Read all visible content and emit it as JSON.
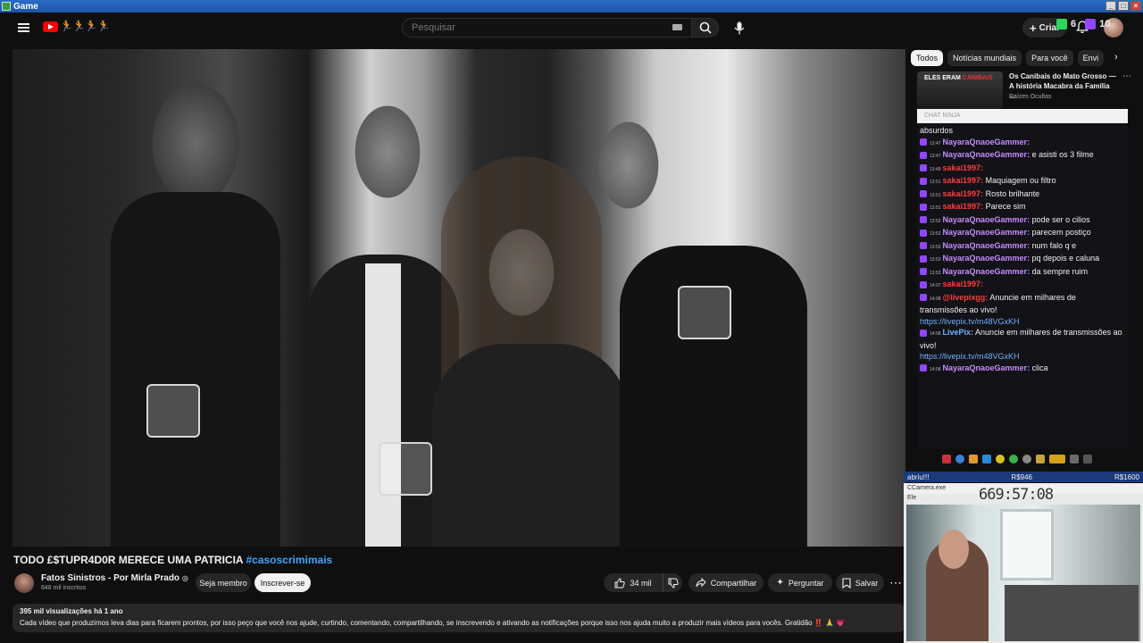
{
  "window": {
    "title": "Game"
  },
  "masthead": {
    "search_placeholder": "Pesquisar",
    "doodle": "🏃🏃🏃🏃",
    "create_label": "Criar"
  },
  "video": {
    "title": "TODO £$TUPR4D0R MERECE UMA PATRICIA",
    "hashtag": "#casoscrimimais"
  },
  "channel": {
    "name": "Fatos Sinistros - Por Mirla Prado",
    "verified_mark": "◎",
    "subscribers": "848 mil inscritos",
    "member_label": "Seja membro",
    "subscribe_label": "Inscrever-se"
  },
  "actions": {
    "likes": "34 mil",
    "share": "Compartilhar",
    "ask": "Perguntar",
    "save": "Salvar"
  },
  "description": {
    "meta": "395 mil visualizações  há 1 ano",
    "body": "Cada vídeo que produzimos leva dias para ficarem prontos, por isso peço que você nos ajude, curtindo, comentando, compartilhando, se inscrevendo e ativando as notificações porque isso nos  ajuda muito a produzir mais vídeos para vocês. Gratidão ‼️ 🙏 💗"
  },
  "sidebar": {
    "chips": [
      "Todos",
      "Notícias mundiais",
      "Para você",
      "Envi"
    ],
    "rec_video": {
      "thumb_text": "ELES ERAM",
      "thumb_text_red": "CANIBAIS",
      "title": "Os Canibais do Mato Grosso — A história Macabra da Família ...",
      "channel": "Raízes Ocultas"
    }
  },
  "chat": {
    "header": "CHAT NINJA",
    "counter_a": "6",
    "counter_b": "10",
    "messages": [
      {
        "time": "",
        "user": "",
        "text": "absurdos",
        "user_color": "#f1f1f1"
      },
      {
        "time": "13:47",
        "user": "NayaraQnaoeGammer:",
        "text": "",
        "user_color": "#c58cff"
      },
      {
        "time": "13:47",
        "user": "NayaraQnaoeGammer:",
        "text": "e asisti os 3 filme",
        "user_color": "#c58cff"
      },
      {
        "time": "13:49",
        "user": "sakai1997:",
        "text": "",
        "user_color": "#ff3c3c"
      },
      {
        "time": "13:51",
        "user": "sakai1997:",
        "text": "Maquiagem ou filtro",
        "user_color": "#ff3c3c"
      },
      {
        "time": "13:51",
        "user": "sakai1997:",
        "text": "Rosto brilhante",
        "user_color": "#ff3c3c"
      },
      {
        "time": "13:51",
        "user": "sakai1997:",
        "text": "Parece sim",
        "user_color": "#ff3c3c"
      },
      {
        "time": "13:52",
        "user": "NayaraQnaoeGammer:",
        "text": "pode ser o cilios",
        "user_color": "#c58cff"
      },
      {
        "time": "13:52",
        "user": "NayaraQnaoeGammer:",
        "text": "parecem postiço",
        "user_color": "#c58cff"
      },
      {
        "time": "13:53",
        "user": "NayaraQnaoeGammer:",
        "text": "num falo q e",
        "user_color": "#c58cff"
      },
      {
        "time": "13:53",
        "user": "NayaraQnaoeGammer:",
        "text": "pq depois e caluna",
        "user_color": "#c58cff"
      },
      {
        "time": "13:53",
        "user": "NayaraQnaoeGammer:",
        "text": "da sempre ruim",
        "user_color": "#c58cff"
      },
      {
        "time": "14:07",
        "user": "sakai1997:",
        "text": "",
        "user_color": "#ff3c3c"
      },
      {
        "time": "14:08",
        "user": "@livepixgg:",
        "text": "Anuncie em milhares de transmissões ao vivo!",
        "user_color": "#ff3c3c"
      },
      {
        "time": "",
        "user": "",
        "text": "https://livepix.tv/m48VGxKH",
        "user_color": "#6fb1ff"
      },
      {
        "time": "14:08",
        "user": "LivePix:",
        "text": "Anuncie em milhares de transmissões ao vivo!",
        "user_color": "#6fb1ff"
      },
      {
        "time": "",
        "user": "",
        "text": "https://livepix.tv/m48VGxKH",
        "user_color": "#6fb1ff"
      },
      {
        "time": "14:08",
        "user": "NayaraQnaoeGammer:",
        "text": "clica",
        "user_color": "#c58cff"
      }
    ]
  },
  "overlay": {
    "bar_left": "abriu!!!",
    "bar_mid": "R$946",
    "bar_right": "R$1600",
    "cam_title": "CCamera.exe",
    "cam_menu": "Ele",
    "timer": "669:57:08"
  },
  "colors": {
    "accent_red": "#ff0000",
    "link_blue": "#3ea6ff"
  }
}
